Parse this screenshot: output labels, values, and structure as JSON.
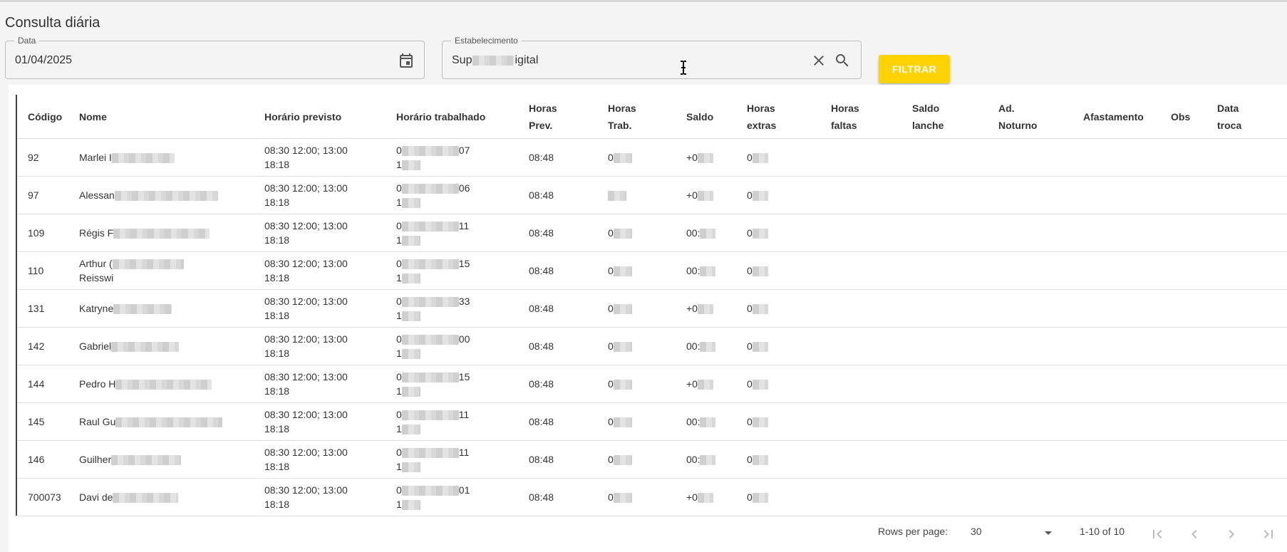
{
  "page": {
    "title": "Consulta diária"
  },
  "filters": {
    "date": {
      "label": "Data",
      "value": "01/04/2025"
    },
    "establishment": {
      "label": "Estabelecimento",
      "value_start": "Sup",
      "value_end": "igital"
    },
    "filter_button": "FILTRAR"
  },
  "table": {
    "columns": [
      {
        "l1": "Código",
        "l2": ""
      },
      {
        "l1": "Nome",
        "l2": ""
      },
      {
        "l1": "Horário previsto",
        "l2": ""
      },
      {
        "l1": "Horário trabalhado",
        "l2": ""
      },
      {
        "l1": "Horas",
        "l2": "Prev."
      },
      {
        "l1": "Horas",
        "l2": "Trab."
      },
      {
        "l1": "Saldo",
        "l2": ""
      },
      {
        "l1": "Horas",
        "l2": "extras"
      },
      {
        "l1": "Horas",
        "l2": "faltas"
      },
      {
        "l1": "Saldo",
        "l2": "lanche"
      },
      {
        "l1": "Ad.",
        "l2": "Noturno"
      },
      {
        "l1": "Afastamento",
        "l2": ""
      },
      {
        "l1": "Obs",
        "l2": ""
      },
      {
        "l1": "Data",
        "l2": "troca"
      }
    ],
    "rows": [
      {
        "codigo": "92",
        "nome1": "Marlei I",
        "nome2": "",
        "prev1": "08:30 12:00; 13:00",
        "prev2": "18:18",
        "trab1a": "0",
        "trab1b": "07",
        "trab2": "1",
        "horas_prev": "08:48",
        "horas_trab": "0",
        "saldo": "+0",
        "extras": "0"
      },
      {
        "codigo": "97",
        "nome1": "Alessan",
        "nome2": "",
        "prev1": "08:30 12:00; 13:00",
        "prev2": "18:18",
        "trab1a": "0",
        "trab1b": "06",
        "trab2": "1",
        "horas_prev": "08:48",
        "horas_trab": "",
        "saldo": "+0",
        "extras": "0"
      },
      {
        "codigo": "109",
        "nome1": "Régis F",
        "nome2": "",
        "prev1": "08:30 12:00; 13:00",
        "prev2": "18:18",
        "trab1a": "0",
        "trab1b": "11",
        "trab2": "1",
        "horas_prev": "08:48",
        "horas_trab": "0",
        "saldo": "00:",
        "extras": "0"
      },
      {
        "codigo": "110",
        "nome1": "Arthur (",
        "nome2": "Reisswi",
        "prev1": "08:30 12:00; 13:00",
        "prev2": "18:18",
        "trab1a": "0",
        "trab1b": "15",
        "trab2": "1",
        "horas_prev": "08:48",
        "horas_trab": "0",
        "saldo": "00:",
        "extras": "0"
      },
      {
        "codigo": "131",
        "nome1": "Katryne",
        "nome2": "",
        "prev1": "08:30 12:00; 13:00",
        "prev2": "18:18",
        "trab1a": "0",
        "trab1b": "33",
        "trab2": "1",
        "horas_prev": "08:48",
        "horas_trab": "0",
        "saldo": "+0",
        "extras": "0"
      },
      {
        "codigo": "142",
        "nome1": "Gabriel",
        "nome2": "",
        "prev1": "08:30 12:00; 13:00",
        "prev2": "18:18",
        "trab1a": "0",
        "trab1b": "00",
        "trab2": "1",
        "horas_prev": "08:48",
        "horas_trab": "0",
        "saldo": "00:",
        "extras": "0"
      },
      {
        "codigo": "144",
        "nome1": "Pedro H",
        "nome2": "",
        "prev1": "08:30 12:00; 13:00",
        "prev2": "18:18",
        "trab1a": "0",
        "trab1b": "15",
        "trab2": "1",
        "horas_prev": "08:48",
        "horas_trab": "0",
        "saldo": "+0",
        "extras": "0"
      },
      {
        "codigo": "145",
        "nome1": "Raul Gu",
        "nome2": "",
        "prev1": "08:30 12:00; 13:00",
        "prev2": "18:18",
        "trab1a": "0",
        "trab1b": "11",
        "trab2": "1",
        "horas_prev": "08:48",
        "horas_trab": "0",
        "saldo": "00:",
        "extras": "0"
      },
      {
        "codigo": "146",
        "nome1": "Guilher",
        "nome2": "",
        "prev1": "08:30 12:00; 13:00",
        "prev2": "18:18",
        "trab1a": "0",
        "trab1b": "11",
        "trab2": "1",
        "horas_prev": "08:48",
        "horas_trab": "0",
        "saldo": "00:",
        "extras": "0"
      },
      {
        "codigo": "700073",
        "nome1": "Davi de",
        "nome2": "",
        "prev1": "08:30 12:00; 13:00",
        "prev2": "18:18",
        "trab1a": "0",
        "trab1b": "01",
        "trab2": "1",
        "horas_prev": "08:48",
        "horas_trab": "0",
        "saldo": "+0",
        "extras": "0"
      }
    ]
  },
  "pagination": {
    "rows_per_page_label": "Rows per page:",
    "rows_per_page_value": "30",
    "range": "1-10 of 10"
  },
  "icons": {
    "calendar": "calendar-icon",
    "clear": "close-icon",
    "search": "search-icon",
    "first": "first-page-icon",
    "prev": "chevron-left-icon",
    "next": "chevron-right-icon",
    "last": "last-page-icon"
  },
  "colors": {
    "accent": "#ffd200"
  }
}
